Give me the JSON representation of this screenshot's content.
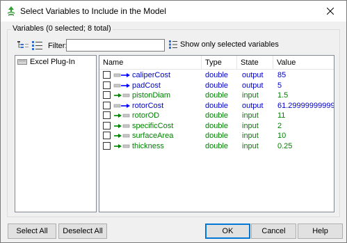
{
  "window": {
    "title": "Select Variables to Include in the Model"
  },
  "group": {
    "label": "Variables (0 selected; 8 total)"
  },
  "toolbar": {
    "filter_label": "Filter:",
    "filter_value": "",
    "show_selected_label": "Show only selected variables"
  },
  "tree": {
    "items": [
      {
        "label": "Excel Plug-In"
      }
    ]
  },
  "table": {
    "headers": {
      "name": "Name",
      "type": "Type",
      "state": "State",
      "value": "Value"
    },
    "rows": [
      {
        "name": "caliperCost",
        "type": "double",
        "state": "output",
        "value": "85",
        "kind": "output"
      },
      {
        "name": "padCost",
        "type": "double",
        "state": "output",
        "value": "5",
        "kind": "output"
      },
      {
        "name": "pistonDiam",
        "type": "double",
        "state": "input",
        "value": "1.5",
        "kind": "input"
      },
      {
        "name": "rotorCost",
        "type": "double",
        "state": "output",
        "value": "61.29999999999...",
        "kind": "output"
      },
      {
        "name": "rotorOD",
        "type": "double",
        "state": "input",
        "value": "11",
        "kind": "input"
      },
      {
        "name": "specificCost",
        "type": "double",
        "state": "input",
        "value": "2",
        "kind": "input"
      },
      {
        "name": "surfaceArea",
        "type": "double",
        "state": "input",
        "value": "10",
        "kind": "input"
      },
      {
        "name": "thickness",
        "type": "double",
        "state": "input",
        "value": "0.25",
        "kind": "input"
      }
    ]
  },
  "buttons": {
    "select_all": "Select All",
    "deselect_all": "Deselect All",
    "ok": "OK",
    "cancel": "Cancel",
    "help": "Help"
  },
  "colors": {
    "input_text": "#008000",
    "output_text": "#0000cc",
    "input_arrow": "#008000",
    "output_arrow": "#0000ff",
    "accent": "#0078d7"
  },
  "icons": {
    "title": "app-logo-icon",
    "close": "close-icon",
    "tree_view": "tree-view-icon",
    "list_view": "list-view-icon",
    "show_selected": "show-selected-icon",
    "plugin": "plugin-icon",
    "input_variable": "input-variable-icon",
    "output_variable": "output-variable-icon"
  }
}
